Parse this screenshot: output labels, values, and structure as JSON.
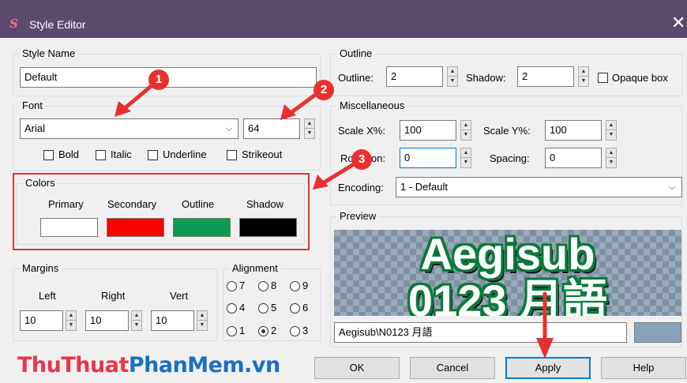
{
  "window": {
    "title": "Style Editor",
    "close_glyph": "✕"
  },
  "style_name": {
    "legend": "Style Name",
    "value": "Default"
  },
  "font": {
    "legend": "Font",
    "family": "Arial",
    "size": "64",
    "bold": "Bold",
    "italic": "Italic",
    "underline": "Underline",
    "strikeout": "Strikeout"
  },
  "colors": {
    "legend": "Colors",
    "primary": "Primary",
    "secondary": "Secondary",
    "outline": "Outline",
    "shadow": "Shadow",
    "primary_color": "#ffffff",
    "secondary_color": "#ff0000",
    "outline_color": "#0a9a50",
    "shadow_color": "#000000"
  },
  "margins": {
    "legend": "Margins",
    "left_label": "Left",
    "right_label": "Right",
    "vert_label": "Vert",
    "left": "10",
    "right": "10",
    "vert": "10"
  },
  "alignment": {
    "legend": "Alignment",
    "options": [
      "7",
      "8",
      "9",
      "4",
      "5",
      "6",
      "1",
      "2",
      "3"
    ],
    "selected": "2"
  },
  "outline": {
    "legend": "Outline",
    "outline_label": "Outline:",
    "outline_value": "2",
    "shadow_label": "Shadow:",
    "shadow_value": "2",
    "opaque_label": "Opaque box"
  },
  "misc": {
    "legend": "Miscellaneous",
    "scale_x_label": "Scale X%:",
    "scale_x": "100",
    "scale_y_label": "Scale Y%:",
    "scale_y": "100",
    "rotation_label_a": "Ro",
    "rotation_label_b": "on:",
    "rotation": "0",
    "spacing_label": "Spacing:",
    "spacing": "0",
    "encoding_label": "Encoding:",
    "encoding": "1 - Default"
  },
  "preview": {
    "legend": "Preview",
    "line1": "Aegisub",
    "line2": "0123 月語",
    "text_value": "Aegisub\\N0123 月語",
    "bg_color": "#8aa2b8"
  },
  "buttons": {
    "ok": "OK",
    "cancel": "Cancel",
    "apply": "Apply",
    "help": "Help"
  },
  "callouts": [
    "1",
    "2",
    "3"
  ],
  "watermark": {
    "part1": "ThuThuat",
    "part2": "PhanMem",
    "part3": ".vn",
    "color1": "#e8354a",
    "color2": "#1a6fc0"
  }
}
